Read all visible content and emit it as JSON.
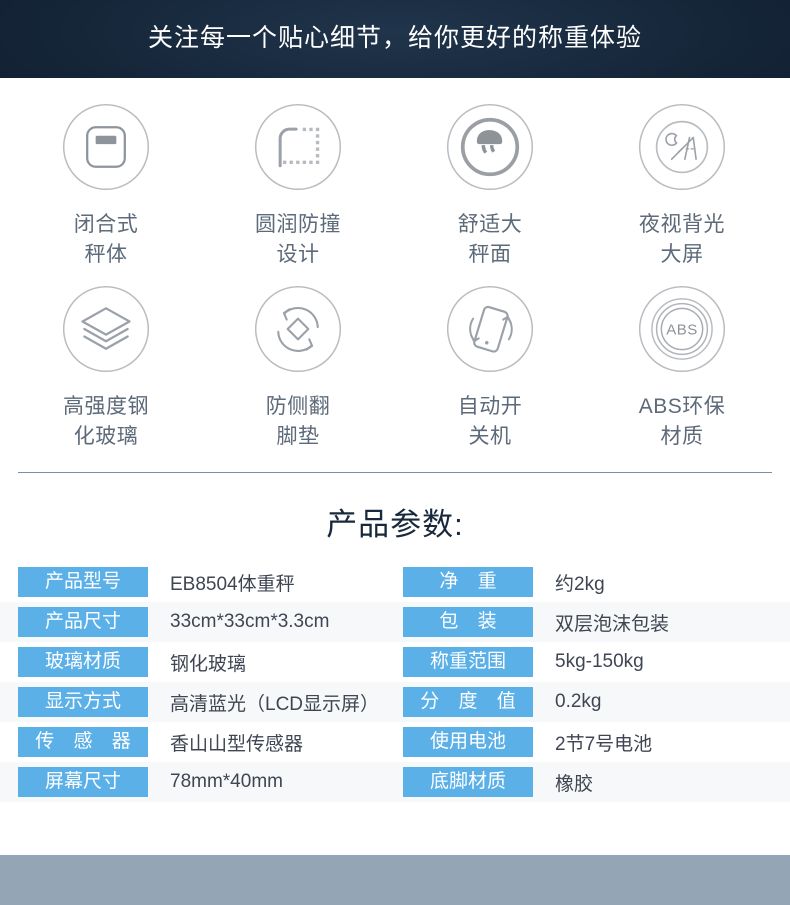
{
  "banner": {
    "title": "关注每一个贴心细节，给你更好的称重体验",
    "background_color": "#122133",
    "text_color": "#ffffff"
  },
  "features": [
    {
      "icon": "scale-body-icon",
      "label": "闭合式\n秤体"
    },
    {
      "icon": "rounded-corner-icon",
      "label": "圆润防撞\n设计"
    },
    {
      "icon": "footprint-circle-icon",
      "label": "舒适大\n秤面"
    },
    {
      "icon": "night-backlight-icon",
      "label": "夜视背光\n大屏"
    },
    {
      "icon": "layered-glass-icon",
      "label": "高强度钢\n化玻璃"
    },
    {
      "icon": "anti-tip-rotate-icon",
      "label": "防侧翻\n脚垫"
    },
    {
      "icon": "auto-power-tilt-icon",
      "label": "自动开\n关机"
    },
    {
      "icon": "abs-material-icon",
      "label": "ABS环保\n材质"
    }
  ],
  "params": {
    "title": "产品参数:",
    "title_color": "#18293d",
    "key_bg_color": "#5bb0e8",
    "key_text_color": "#ffffff",
    "value_text_color": "#3f4652",
    "rows": [
      {
        "left": {
          "key": "产品型号",
          "value": "EB8504体重秤",
          "spaced": false
        },
        "right": {
          "key": "净 重",
          "value": "约2kg",
          "spaced": true
        }
      },
      {
        "left": {
          "key": "产品尺寸",
          "value": "33cm*33cm*3.3cm",
          "spaced": false
        },
        "right": {
          "key": "包 装",
          "value": "双层泡沫包装",
          "spaced": true
        }
      },
      {
        "left": {
          "key": "玻璃材质",
          "value": "钢化玻璃",
          "spaced": false
        },
        "right": {
          "key": "称重范围",
          "value": "5kg-150kg",
          "spaced": false
        }
      },
      {
        "left": {
          "key": "显示方式",
          "value": "高清蓝光（LCD显示屏）",
          "spaced": false
        },
        "right": {
          "key": "分 度 值",
          "value": "0.2kg",
          "spaced": true
        }
      },
      {
        "left": {
          "key": "传 感 器",
          "value": "香山山型传感器",
          "spaced": true
        },
        "right": {
          "key": "使用电池",
          "value": "2节7号电池",
          "spaced": false
        }
      },
      {
        "left": {
          "key": "屏幕尺寸",
          "value": "78mm*40mm",
          "spaced": false
        },
        "right": {
          "key": "底脚材质",
          "value": "橡胶",
          "spaced": false
        }
      }
    ]
  },
  "footer": {
    "background_color": "#94a5b6"
  }
}
